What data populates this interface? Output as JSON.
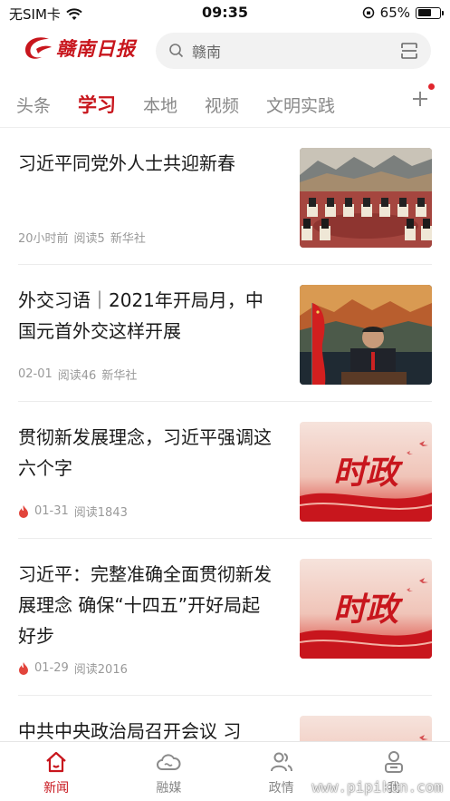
{
  "status_bar": {
    "carrier": "无SIM卡",
    "time": "09:35",
    "battery": "65%",
    "battery_level": 0.65
  },
  "header": {
    "logo_text": "赣南日报",
    "search_text": "赣南"
  },
  "tabs": [
    {
      "label": "头条",
      "active": false
    },
    {
      "label": "学习",
      "active": true
    },
    {
      "label": "本地",
      "active": false
    },
    {
      "label": "视频",
      "active": false
    },
    {
      "label": "文明实践",
      "active": false
    }
  ],
  "feed": [
    {
      "title": "习近平同党外人士共迎新春",
      "time": "20小时前",
      "reads": "阅读5",
      "source": "新华社",
      "hot": false,
      "thumb": "meeting-hall-photo"
    },
    {
      "title": "外交习语｜2021年开局月，中国元首外交这样开展",
      "time": "02-01",
      "reads": "阅读46",
      "source": "新华社",
      "hot": false,
      "thumb": "leader-video-call-photo"
    },
    {
      "title": "贯彻新发展理念，习近平强调这六个字",
      "time": "01-31",
      "reads": "阅读1843",
      "source": "",
      "hot": true,
      "thumb": "shizheng-banner",
      "thumb_text": "时政"
    },
    {
      "title": "习近平：完整准确全面贯彻新发展理念 确保“十四五”开好局起好步",
      "time": "01-29",
      "reads": "阅读2016",
      "source": "",
      "hot": true,
      "thumb": "shizheng-banner",
      "thumb_text": "时政"
    },
    {
      "title": "中共中央政治局召开会议 习",
      "time": "",
      "reads": "",
      "source": "",
      "hot": false,
      "thumb": "shizheng-banner"
    }
  ],
  "tabbar": [
    {
      "label": "新闻",
      "icon": "home-icon",
      "active": true
    },
    {
      "label": "融媒",
      "icon": "cloud-icon",
      "active": false
    },
    {
      "label": "政情",
      "icon": "people-icon",
      "active": false
    },
    {
      "label": "我",
      "icon": "person-icon",
      "active": false
    }
  ],
  "watermark": "www.pipikun.com",
  "colors": {
    "accent": "#c8161d",
    "muted": "#999999"
  }
}
